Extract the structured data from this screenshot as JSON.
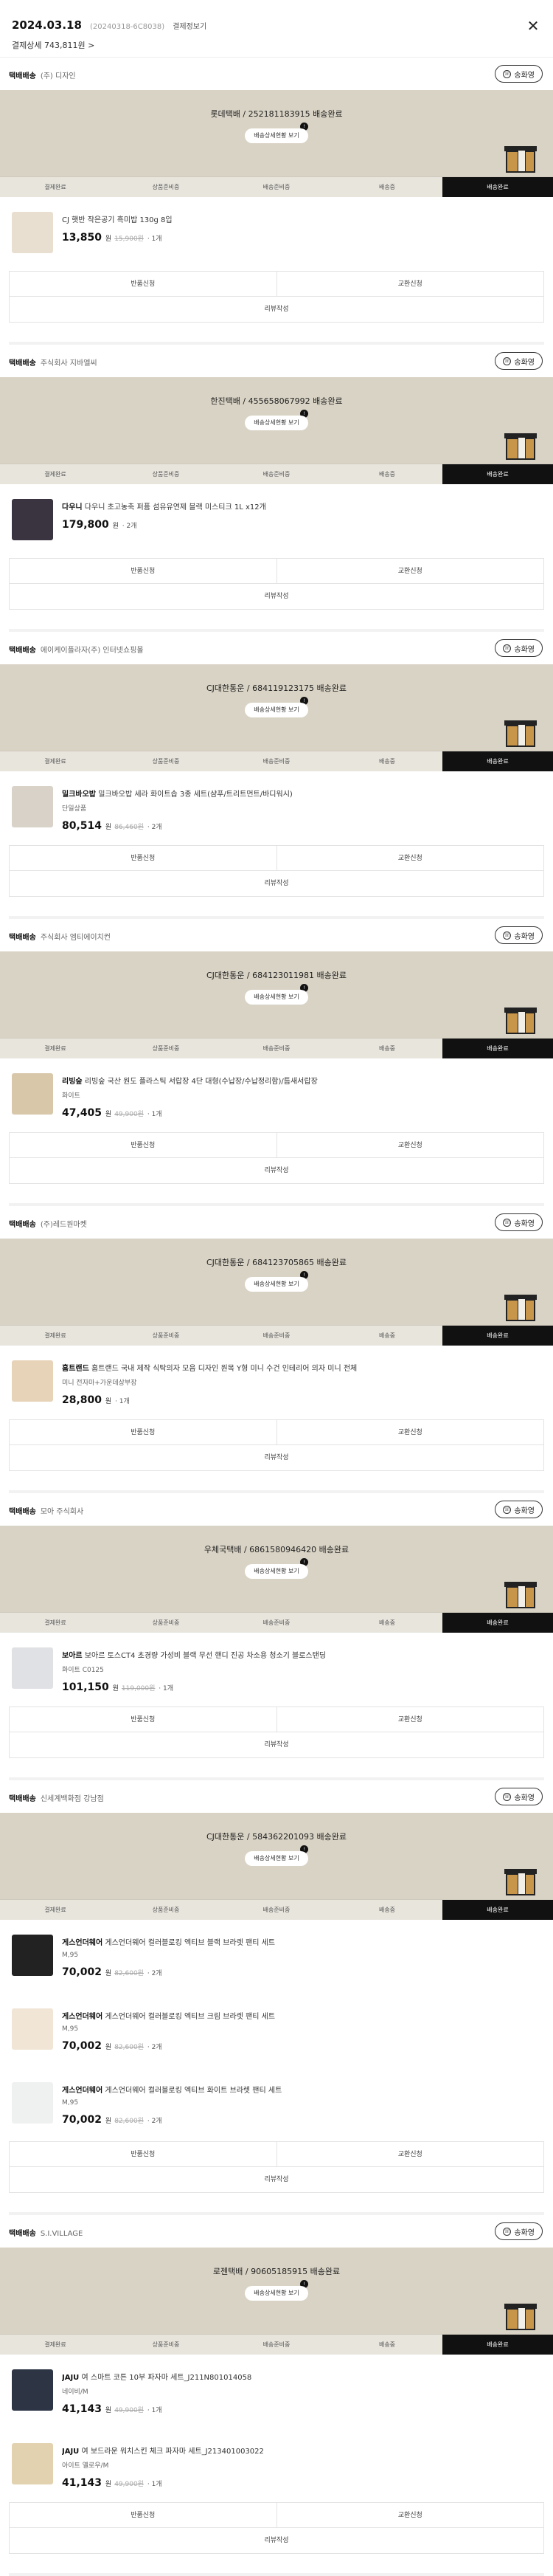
{
  "header": {
    "date": "2024.03.18",
    "order_no": "(20240318-6C8038)",
    "cancel_link": "결제정보기",
    "pay_detail": "결제상세 743,811원 >"
  },
  "common": {
    "track_button": "배송상세현황 보기",
    "contact_button": "송화영",
    "steps": [
      "결제완료",
      "상품준비중",
      "배송준비중",
      "배송중",
      "배송완료"
    ],
    "return_label": "반품신청",
    "exchange_label": "교환신청",
    "review_label": "리뷰작성",
    "won": "원"
  },
  "shipments": [
    {
      "method": "택배배송",
      "seller": "(주) 디자인",
      "courier": "롯데택배 / 252181183915 배송완료",
      "products": [
        {
          "brand": "",
          "name": "CJ 햇반 작은공기 흑미밥 130g 8입",
          "option": "",
          "price": "13,850",
          "orig": "15,900원",
          "qty": "· 1개"
        }
      ]
    },
    {
      "method": "택배배송",
      "seller": "주식회사 지바엘씨",
      "courier": "한진택배 / 455658067992 배송완료",
      "products": [
        {
          "brand": "다우니",
          "name": "다우니 초고농축 퍼퓸 섬유유연제 블랙 미스티크 1L x12개",
          "option": "",
          "price": "179,800",
          "orig": "",
          "qty": "· 2개"
        }
      ]
    },
    {
      "method": "택배배송",
      "seller": "에이케이플라자(주) 인터넷쇼핑몰",
      "courier": "CJ대한통운 / 684119123175 배송완료",
      "products": [
        {
          "brand": "밀크바오밥",
          "name": "밀크바오밥 세라 화이트솝 3종 세트(샴푸/트리트먼트/바디워시)",
          "option": "단일상품",
          "price": "80,514",
          "orig": "86,460원",
          "qty": "· 2개"
        }
      ]
    },
    {
      "method": "택배배송",
      "seller": "주식회사 엠티에이치컨",
      "courier": "CJ대한통운 / 684123011981 배송완료",
      "products": [
        {
          "brand": "리빙숲",
          "name": "리빙숲 국산 원도 플라스틱 서랍장 4단 대형(수납장/수납정리함)/틈새서랍장",
          "option": "화이트",
          "price": "47,405",
          "orig": "49,900원",
          "qty": "· 1개"
        }
      ]
    },
    {
      "method": "택배배송",
      "seller": "(주)레드원마켓",
      "courier": "CJ대한통운 / 684123705865 배송완료",
      "products": [
        {
          "brand": "홈트랜드",
          "name": "홈트랜드 국내 제작 식탁의자 모음 디자인 원목 Y형 미니 수건 인테리어 의자 미니 전체",
          "option": "미니 전자마+가운데상부장",
          "price": "28,800",
          "orig": "",
          "qty": "· 1개"
        }
      ]
    },
    {
      "method": "택배배송",
      "seller": "모아 주식회사",
      "courier": "우체국택배 / 6861580946420 배송완료",
      "products": [
        {
          "brand": "보아르",
          "name": "보아르 토스CT4 초경량 가성비 블랙 무선 핸디 진공 차소용 청소기 블로스탠딩",
          "option": "화이트 C0125",
          "price": "101,150",
          "orig": "119,000원",
          "qty": "· 1개"
        }
      ]
    },
    {
      "method": "택배배송",
      "seller": "신세계백화점 강남점",
      "courier": "CJ대한통운 / 584362201093 배송완료",
      "products": [
        {
          "brand": "게스언더웨어",
          "name": "게스언더웨어 컬러블로킹 엑티브 블랙 브라렛 팬티 세트",
          "option": "M,95",
          "price": "70,002",
          "orig": "82,600원",
          "qty": "· 2개"
        },
        {
          "brand": "게스언더웨어",
          "name": "게스언더웨어 컬러블로킹 엑티브 크림 브라렛 팬티 세트",
          "option": "M,95",
          "price": "70,002",
          "orig": "82,600원",
          "qty": "· 2개"
        },
        {
          "brand": "게스언더웨어",
          "name": "게스언더웨어 컬러블로킹 엑티브 화이트 브라렛 팬티 세트",
          "option": "M,95",
          "price": "70,002",
          "orig": "82,600원",
          "qty": "· 2개"
        }
      ]
    },
    {
      "method": "택배배송",
      "seller": "S.I.VILLAGE",
      "courier": "로젠택배 / 90605185915 배송완료",
      "products": [
        {
          "brand": "JAJU",
          "name": "여 스마트 코튼 10부 파자마 세트_J211N801014058",
          "option": "네이비/M",
          "price": "41,143",
          "orig": "49,900원",
          "qty": "· 1개"
        },
        {
          "brand": "JAJU",
          "name": "여 보드라운 워치스킨 체크 파자마 세트_J213401003022",
          "option": "아이트 옐로우/M",
          "price": "41,143",
          "orig": "49,900원",
          "qty": "· 1개"
        }
      ]
    }
  ]
}
